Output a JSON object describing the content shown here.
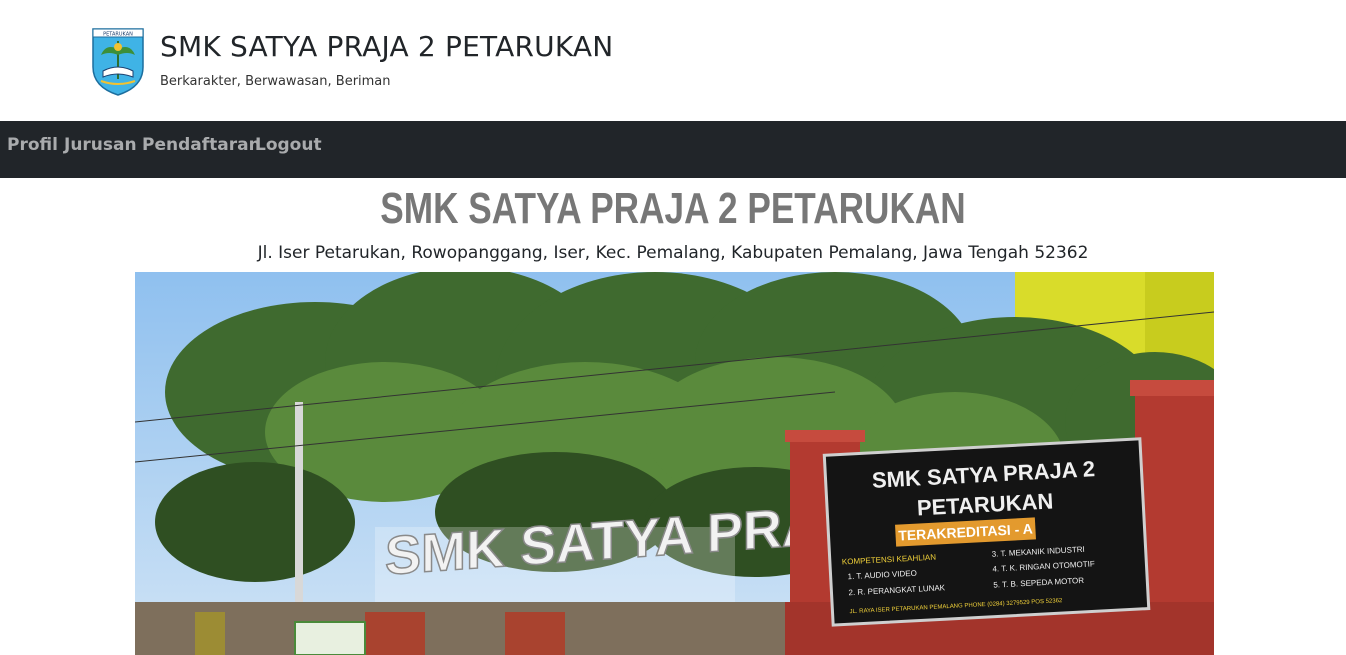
{
  "header": {
    "title": "SMK SATYA PRAJA 2 PETARUKAN",
    "tagline": "Berkarakter, Berwawasan, Beriman",
    "logo_text": "PETARUKAN"
  },
  "nav": {
    "items": [
      {
        "label": "Profil"
      },
      {
        "label": "Jurusan"
      },
      {
        "label": "Pendaftaran"
      },
      {
        "label": "Logout"
      }
    ]
  },
  "main": {
    "title": "SMK SATYA PRAJA 2 PETARUKAN",
    "address": "Jl. Iser Petarukan, Rowopanggang, Iser, Kec. Pemalang, Kabupaten Pemalang, Jawa Tengah 52362"
  },
  "hero_photo": {
    "gate_sign": "SMK SATYA PRAJA 2",
    "board_line1": "SMK SATYA PRAJA 2",
    "board_line2": "PETARUKAN",
    "board_accreditation": "TERAKREDITASI - A",
    "board_competency": "KOMPETENSI KEAHLIAN",
    "board_item1": "1. T. AUDIO VIDEO",
    "board_item2": "2. R. PERANGKAT LUNAK",
    "board_item3": "3. T. MEKANIK INDUSTRI",
    "board_item4": "4. T. K. RINGAN OTOMOTIF",
    "board_item5": "5. T. B. SEPEDA MOTOR",
    "board_footer": "JL. RAYA ISER PETARUKAN PEMALANG PHONE (0284) 3279529 POS 52362"
  },
  "colors": {
    "navbar_bg": "#212529",
    "nav_link": "#a9abad",
    "main_title": "#777777",
    "sky": "#a9cdf2",
    "gate_red": "#b33a30",
    "board_black": "#141414",
    "accreditation_orange": "#e39a2e"
  }
}
